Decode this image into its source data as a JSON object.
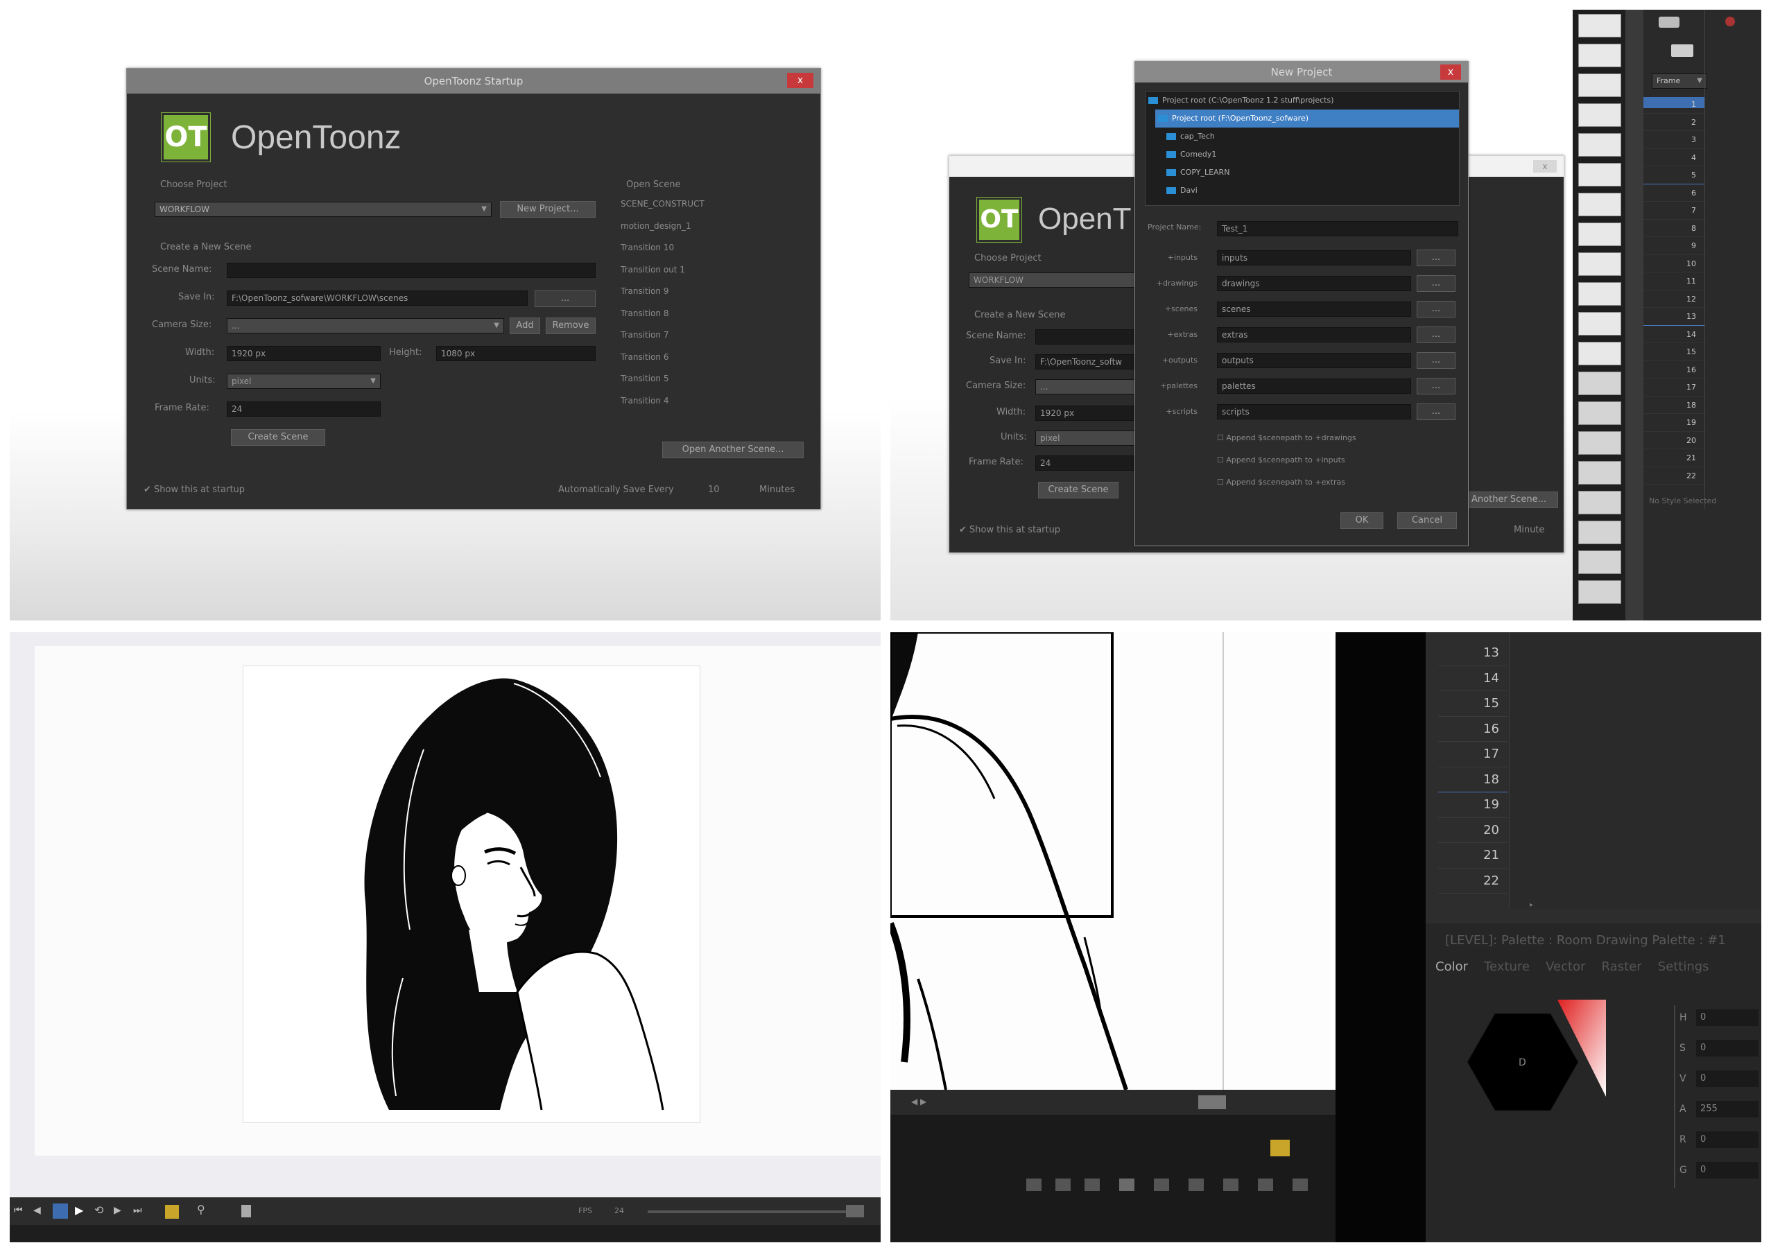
{
  "startup_dialog": {
    "title": "OpenToonz Startup",
    "close": "x",
    "logo_text": "OT",
    "brand": "OpenToonz",
    "choose_project_label": "Choose Project",
    "project_value": "WORKFLOW",
    "new_project_button": "New Project...",
    "create_scene_label": "Create a New Scene",
    "scene_name_label": "Scene Name:",
    "scene_name_value": "",
    "save_in_label": "Save In:",
    "save_in_value": "F:\\OpenToonz_sofware\\WORKFLOW\\scenes",
    "browse_button": "...",
    "camera_size_label": "Camera Size:",
    "camera_size_value": "...",
    "add_button": "Add",
    "remove_button": "Remove",
    "width_label": "Width:",
    "width_value": "1920 px",
    "height_label": "Height:",
    "height_value": "1080 px",
    "units_label": "Units:",
    "units_value": "pixel",
    "frame_rate_label": "Frame Rate:",
    "frame_rate_value": "24",
    "create_scene_button": "Create Scene",
    "open_scene_label": "Open Scene",
    "scenes": [
      "SCENE_CONSTRUCT",
      "motion_design_1",
      "Transition 10",
      "Transition out 1",
      "Transition 9",
      "Transition 8",
      "Transition 7",
      "Transition 6",
      "Transition 5",
      "Transition 4"
    ],
    "open_another_button": "Open Another Scene...",
    "show_at_startup": "Show this at startup",
    "autosave_label": "Automatically Save Every",
    "autosave_value": "10",
    "minutes_label": "Minutes"
  },
  "new_project_dialog": {
    "title": "New Project",
    "close": "x",
    "tree_items": [
      {
        "label": "Project root (C:\\OpenToonz 1.2 stuff\\projects)",
        "selected": false
      },
      {
        "label": "Project root (F:\\OpenToonz_sofware)",
        "selected": true
      },
      {
        "label": "cap_Tech",
        "selected": false
      },
      {
        "label": "Comedy1",
        "selected": false
      },
      {
        "label": "COPY_LEARN",
        "selected": false
      },
      {
        "label": "Davi",
        "selected": false
      }
    ],
    "project_name_label": "Project Name:",
    "project_name_value": "Test_1",
    "folders": [
      {
        "label": "+inputs",
        "value": "inputs"
      },
      {
        "label": "+drawings",
        "value": "drawings"
      },
      {
        "label": "+scenes",
        "value": "scenes"
      },
      {
        "label": "+extras",
        "value": "extras"
      },
      {
        "label": "+outputs",
        "value": "outputs"
      },
      {
        "label": "+palettes",
        "value": "palettes"
      },
      {
        "label": "+scripts",
        "value": "scripts"
      }
    ],
    "browse": "...",
    "append_options": [
      "Append $scenepath to +drawings",
      "Append $scenepath to +inputs",
      "Append $scenepath to +extras"
    ],
    "ok_button": "OK",
    "cancel_button": "Cancel"
  },
  "behind_startup": {
    "brand": "OpenT",
    "choose_project_label": "Choose Project",
    "project_value": "WORKFLOW",
    "create_scene_label": "Create a New Scene",
    "scene_name_label": "Scene Name:",
    "save_in_label": "Save In:",
    "save_in_value": "F:\\OpenToonz_softw",
    "camera_size_label": "Camera Size:",
    "camera_size_value": "...",
    "width_label": "Width:",
    "width_value": "1920 px",
    "units_label": "Units:",
    "units_value": "pixel",
    "frame_rate_label": "Frame Rate:",
    "frame_rate_value": "24",
    "create_scene_button": "Create Scene",
    "open_another_button": "Another Scene...",
    "show_at_startup": "Show this at startup",
    "minutes_label": "Minute"
  },
  "xsheet_right": {
    "frame_dropdown": "Frame",
    "frames": [
      "1",
      "2",
      "3",
      "4",
      "5",
      "6",
      "7",
      "8",
      "9",
      "10",
      "11",
      "12",
      "13",
      "14",
      "15",
      "16",
      "17",
      "18",
      "19",
      "20",
      "21",
      "22"
    ],
    "no_style": "No Style Selected"
  },
  "viewer_bottom": {
    "fps_label": "FPS",
    "fps_value": "24"
  },
  "closeup": {
    "frames": [
      "13",
      "14",
      "15",
      "16",
      "17",
      "18",
      "19",
      "20",
      "21",
      "22"
    ],
    "palette_title": "[LEVEL]: Palette : Room Drawing Palette : #1",
    "tabs": [
      "Color",
      "Texture",
      "Vector",
      "Raster",
      "Settings"
    ],
    "channels": [
      {
        "label": "H",
        "value": "0"
      },
      {
        "label": "S",
        "value": "0"
      },
      {
        "label": "V",
        "value": "0"
      },
      {
        "label": "A",
        "value": "255"
      },
      {
        "label": "R",
        "value": "0"
      },
      {
        "label": "G",
        "value": "0"
      }
    ],
    "wheel_center": "D",
    "accent_red": "#d62020",
    "tool_highlight": "#c9a52a"
  }
}
